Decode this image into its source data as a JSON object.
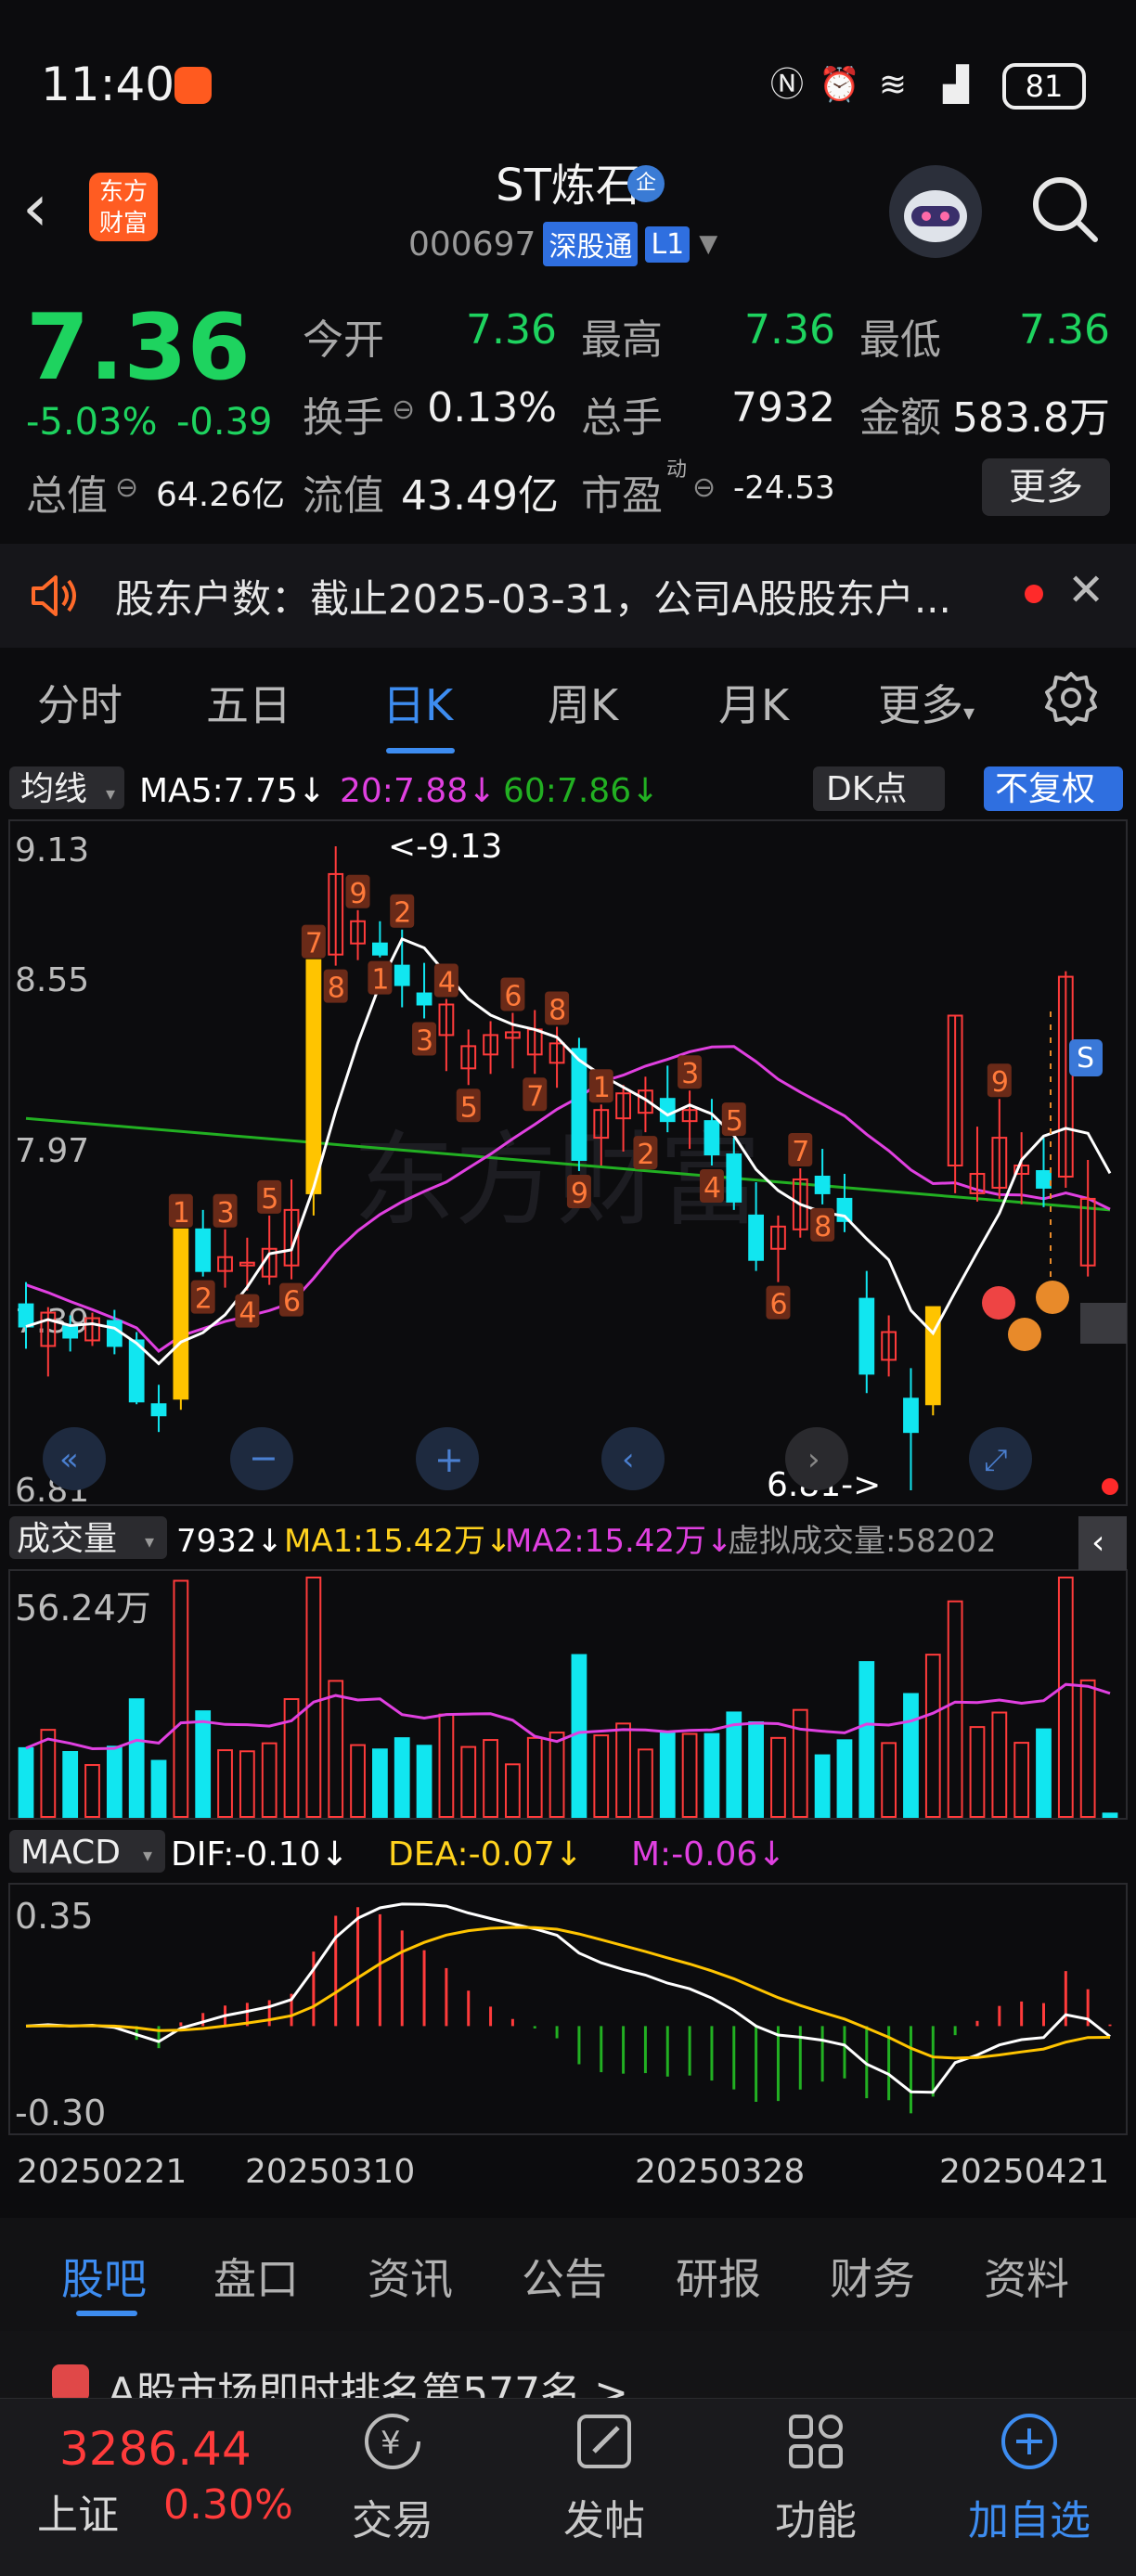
{
  "status_bar": {
    "time": "11:40",
    "battery": "81"
  },
  "header": {
    "back_icon": "back-chevron-icon",
    "logo_line1": "东方",
    "logo_line2": "财富",
    "stock_name": "ST炼石",
    "badge_qi": "企",
    "code": "000697",
    "tag_sgt": "深股通",
    "tag_level": "L1"
  },
  "quote": {
    "price": "7.36",
    "change_pct": "-5.03%",
    "change_abs": "-0.39",
    "open_label": "今开",
    "open": "7.36",
    "high_label": "最高",
    "high": "7.36",
    "low_label": "最低",
    "low": "7.36",
    "turnover_label": "换手",
    "turnover": "0.13%",
    "volume_label": "总手",
    "volume": "7932",
    "amount_label": "金额",
    "amount": "583.8万",
    "mktcap_label": "总值",
    "mktcap": "64.26亿",
    "float_label": "流值",
    "float_cap": "43.49亿",
    "pe_label": "市盈",
    "pe_super": "动",
    "pe": "-24.53",
    "more_label": "更多"
  },
  "notice": {
    "text": "股东户数：截止2025-03-31，公司A股股东户..."
  },
  "period_tabs": [
    "分时",
    "五日",
    "日K",
    "周K",
    "月K",
    "更多"
  ],
  "chart": {
    "ma_dropdown": "均线",
    "ma5": "MA5:7.75",
    "ma20": "20:7.88",
    "ma60": "60:7.86",
    "dk_label": "DK点",
    "fq_label": "不复权",
    "price_ticks": [
      "9.13",
      "8.55",
      "7.97",
      "7.39",
      "6.81"
    ],
    "high_marker": "<-9.13",
    "low_marker": "6.81->",
    "vol_dropdown": "成交量",
    "vol_value": "7932",
    "vol_ma1": "MA1:15.42万",
    "vol_ma2": "MA2:15.42万",
    "vol_virtual": "虚拟成交量:58202",
    "vol_top": "56.24万",
    "macd_dropdown": "MACD",
    "dif": "DIF:-0.10",
    "dea": "DEA:-0.07",
    "m": "M:-0.06",
    "macd_top": "0.35",
    "macd_bottom": "-0.30",
    "dates": [
      "20250221",
      "20250310",
      "20250328",
      "20250421"
    ],
    "colors": {
      "up": "#ff3b3b",
      "down": "#11e6f0",
      "ma5": "#ffffff",
      "ma20": "#e040e0",
      "ma60": "#22b022",
      "yellow": "#ffc400"
    }
  },
  "chart_data": {
    "type": "candlestick",
    "ylim": [
      6.81,
      9.13
    ],
    "candles": [
      {
        "o": 7.48,
        "h": 7.56,
        "l": 7.32,
        "c": 7.4
      },
      {
        "o": 7.33,
        "h": 7.47,
        "l": 7.22,
        "c": 7.45
      },
      {
        "o": 7.4,
        "h": 7.44,
        "l": 7.31,
        "c": 7.36
      },
      {
        "o": 7.35,
        "h": 7.45,
        "l": 7.33,
        "c": 7.43
      },
      {
        "o": 7.42,
        "h": 7.46,
        "l": 7.3,
        "c": 7.33
      },
      {
        "o": 7.35,
        "h": 7.38,
        "l": 7.12,
        "c": 7.13
      },
      {
        "o": 7.12,
        "h": 7.19,
        "l": 7.02,
        "c": 7.08
      },
      {
        "o": 7.14,
        "h": 7.75,
        "l": 7.1,
        "c": 7.75
      },
      {
        "o": 7.75,
        "h": 7.82,
        "l": 7.58,
        "c": 7.6
      },
      {
        "o": 7.6,
        "h": 7.75,
        "l": 7.54,
        "c": 7.65
      },
      {
        "o": 7.63,
        "h": 7.72,
        "l": 7.53,
        "c": 7.63
      },
      {
        "o": 7.58,
        "h": 7.8,
        "l": 7.55,
        "c": 7.68
      },
      {
        "o": 7.62,
        "h": 7.93,
        "l": 7.57,
        "c": 7.82
      },
      {
        "o": 7.88,
        "h": 8.72,
        "l": 7.8,
        "c": 8.72
      },
      {
        "o": 8.74,
        "h": 9.13,
        "l": 8.7,
        "c": 9.03
      },
      {
        "o": 8.78,
        "h": 8.9,
        "l": 8.72,
        "c": 8.86
      },
      {
        "o": 8.78,
        "h": 8.86,
        "l": 8.73,
        "c": 8.74
      },
      {
        "o": 8.7,
        "h": 8.83,
        "l": 8.55,
        "c": 8.63
      },
      {
        "o": 8.6,
        "h": 8.71,
        "l": 8.51,
        "c": 8.56
      },
      {
        "o": 8.45,
        "h": 8.58,
        "l": 8.32,
        "c": 8.56
      },
      {
        "o": 8.33,
        "h": 8.47,
        "l": 8.27,
        "c": 8.41
      },
      {
        "o": 8.38,
        "h": 8.5,
        "l": 8.31,
        "c": 8.45
      },
      {
        "o": 8.44,
        "h": 8.53,
        "l": 8.33,
        "c": 8.46
      },
      {
        "o": 8.38,
        "h": 8.54,
        "l": 8.31,
        "c": 8.47
      },
      {
        "o": 8.35,
        "h": 8.48,
        "l": 8.26,
        "c": 8.42
      },
      {
        "o": 8.4,
        "h": 8.44,
        "l": 7.96,
        "c": 8.0
      },
      {
        "o": 8.08,
        "h": 8.2,
        "l": 7.98,
        "c": 8.18
      },
      {
        "o": 8.15,
        "h": 8.27,
        "l": 8.03,
        "c": 8.24
      },
      {
        "o": 8.17,
        "h": 8.3,
        "l": 8.1,
        "c": 8.25
      },
      {
        "o": 8.22,
        "h": 8.34,
        "l": 8.1,
        "c": 8.14
      },
      {
        "o": 8.14,
        "h": 8.25,
        "l": 8.04,
        "c": 8.18
      },
      {
        "o": 8.14,
        "h": 8.22,
        "l": 7.98,
        "c": 8.02
      },
      {
        "o": 8.02,
        "h": 8.08,
        "l": 7.82,
        "c": 7.85
      },
      {
        "o": 7.8,
        "h": 7.92,
        "l": 7.6,
        "c": 7.64
      },
      {
        "o": 7.68,
        "h": 7.8,
        "l": 7.56,
        "c": 7.76
      },
      {
        "o": 7.75,
        "h": 7.97,
        "l": 7.72,
        "c": 7.93
      },
      {
        "o": 7.94,
        "h": 8.04,
        "l": 7.84,
        "c": 7.88
      },
      {
        "o": 7.86,
        "h": 7.95,
        "l": 7.74,
        "c": 7.78
      },
      {
        "o": 7.5,
        "h": 7.6,
        "l": 7.16,
        "c": 7.23
      },
      {
        "o": 7.28,
        "h": 7.44,
        "l": 7.22,
        "c": 7.38
      },
      {
        "o": 7.14,
        "h": 7.25,
        "l": 6.81,
        "c": 7.02
      },
      {
        "o": 7.12,
        "h": 7.47,
        "l": 7.08,
        "c": 7.47
      },
      {
        "o": 7.98,
        "h": 8.52,
        "l": 7.88,
        "c": 8.52
      },
      {
        "o": 7.88,
        "h": 8.12,
        "l": 7.85,
        "c": 7.95
      },
      {
        "o": 7.9,
        "h": 8.22,
        "l": 7.86,
        "c": 8.08
      },
      {
        "o": 7.95,
        "h": 8.1,
        "l": 7.84,
        "c": 7.98
      },
      {
        "o": 7.96,
        "h": 8.08,
        "l": 7.83,
        "c": 7.9
      },
      {
        "o": 7.94,
        "h": 8.68,
        "l": 7.9,
        "c": 8.66
      },
      {
        "o": 7.62,
        "h": 8.0,
        "l": 7.58,
        "c": 7.86
      },
      {
        "o": 7.39,
        "h": 7.46,
        "l": 7.36,
        "c": 7.36
      }
    ],
    "volume_max": 562400,
    "macd_range": [
      -0.3,
      0.35
    ]
  },
  "bottom_tabs": [
    "股吧",
    "盘口",
    "资讯",
    "公告",
    "研报",
    "财务",
    "资料"
  ],
  "news": {
    "text": "A股市场即时排名第577名 >"
  },
  "index": {
    "value": "3286.44",
    "name": "上证",
    "pct": "0.30%"
  },
  "nav": {
    "trade": "交易",
    "post": "发帖",
    "func": "功能",
    "add": "加自选"
  }
}
